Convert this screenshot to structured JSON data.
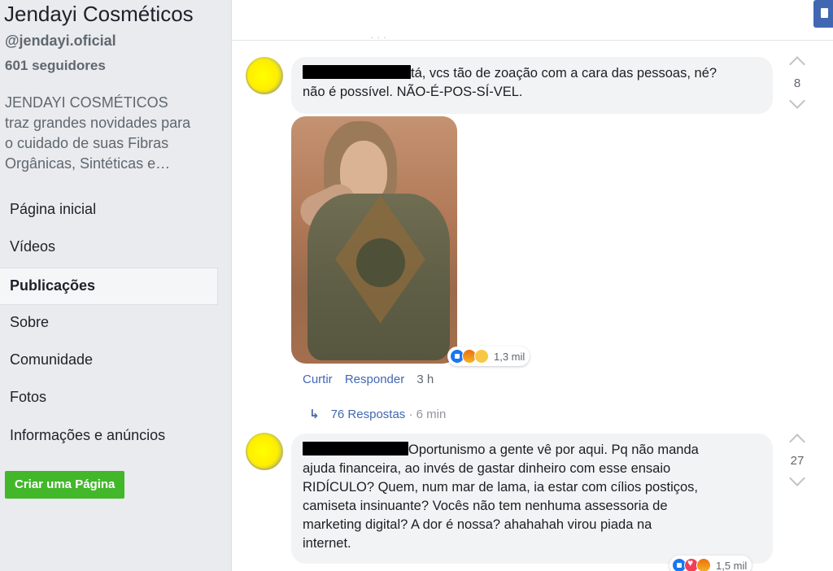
{
  "page": {
    "name": "Jendayi Cosméticos",
    "handle": "@jendayi.oficial",
    "followers": "601 seguidores",
    "about": "JENDAYI COSMÉTICOS\ntraz grandes novidades para\no cuidado de suas Fibras\nOrgânicas, Sintéticas e…"
  },
  "nav": {
    "items": [
      {
        "label": "Página inicial"
      },
      {
        "label": "Vídeos"
      },
      {
        "label": "Publicações"
      },
      {
        "label": "Sobre"
      },
      {
        "label": "Comunidade"
      },
      {
        "label": "Fotos"
      },
      {
        "label": "Informações e anúncios"
      }
    ],
    "active_label": "Publicações",
    "create_page_label": "Criar uma Página"
  },
  "comments": [
    {
      "text_line1": "tá, vcs tão de zoação com a cara das pessoas, né?",
      "text_line2": "não é possível. NÃO-É-POS-SÍ-VEL.",
      "votes": "8",
      "reactions": {
        "icons": [
          "like",
          "angry",
          "sad"
        ],
        "count": "1,3 mil"
      },
      "actions": {
        "like": "Curtir",
        "reply": "Responder",
        "time": "3 h"
      },
      "replies": {
        "label": "76 Respostas",
        "separator": "·",
        "time": "6 min"
      }
    },
    {
      "text_line1": "Oportunismo a gente vê por aqui. Pq não manda",
      "text_rest": "ajuda financeira, ao invés de gastar dinheiro com esse ensaio\nRIDÍCULO? Quem, num mar de lama, ia estar com cílios postiços,\ncamiseta insinuante? Vocês não tem nenhuma assessoria de\nmarketing digital? A dor é nossa? ahahahah virou piada na\ninternet.",
      "votes": "27",
      "reactions": {
        "icons": [
          "like",
          "love",
          "angry"
        ],
        "count": "1,5 mil"
      }
    }
  ],
  "colors": {
    "link": "#4267b2",
    "create_button": "#42b72a",
    "bubble": "#f2f3f5"
  }
}
